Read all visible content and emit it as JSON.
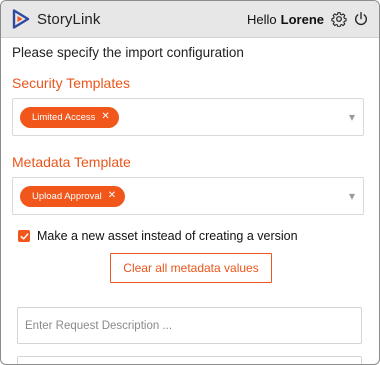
{
  "header": {
    "app_name": "StoryLink",
    "greeting": "Hello",
    "user_name": "Lorene",
    "icons": [
      "logo-play-icon",
      "gear-icon",
      "power-icon"
    ]
  },
  "main": {
    "intro": "Please specify the import configuration",
    "security": {
      "label": "Security Templates",
      "chips": [
        {
          "label": "Limited Access"
        }
      ]
    },
    "metadata": {
      "label": "Metadata Template",
      "chips": [
        {
          "label": "Upload Approval"
        }
      ]
    },
    "new_asset": {
      "label": "Make a new asset instead of creating a version",
      "checked": true
    },
    "clear_button": "Clear all metadata values",
    "request_description": {
      "placeholder": "Enter Request Description ...",
      "value": ""
    }
  },
  "colors": {
    "accent": "#f1561b",
    "header_bg": "#e7e7e7",
    "logo_blue": "#2f4a9e"
  }
}
